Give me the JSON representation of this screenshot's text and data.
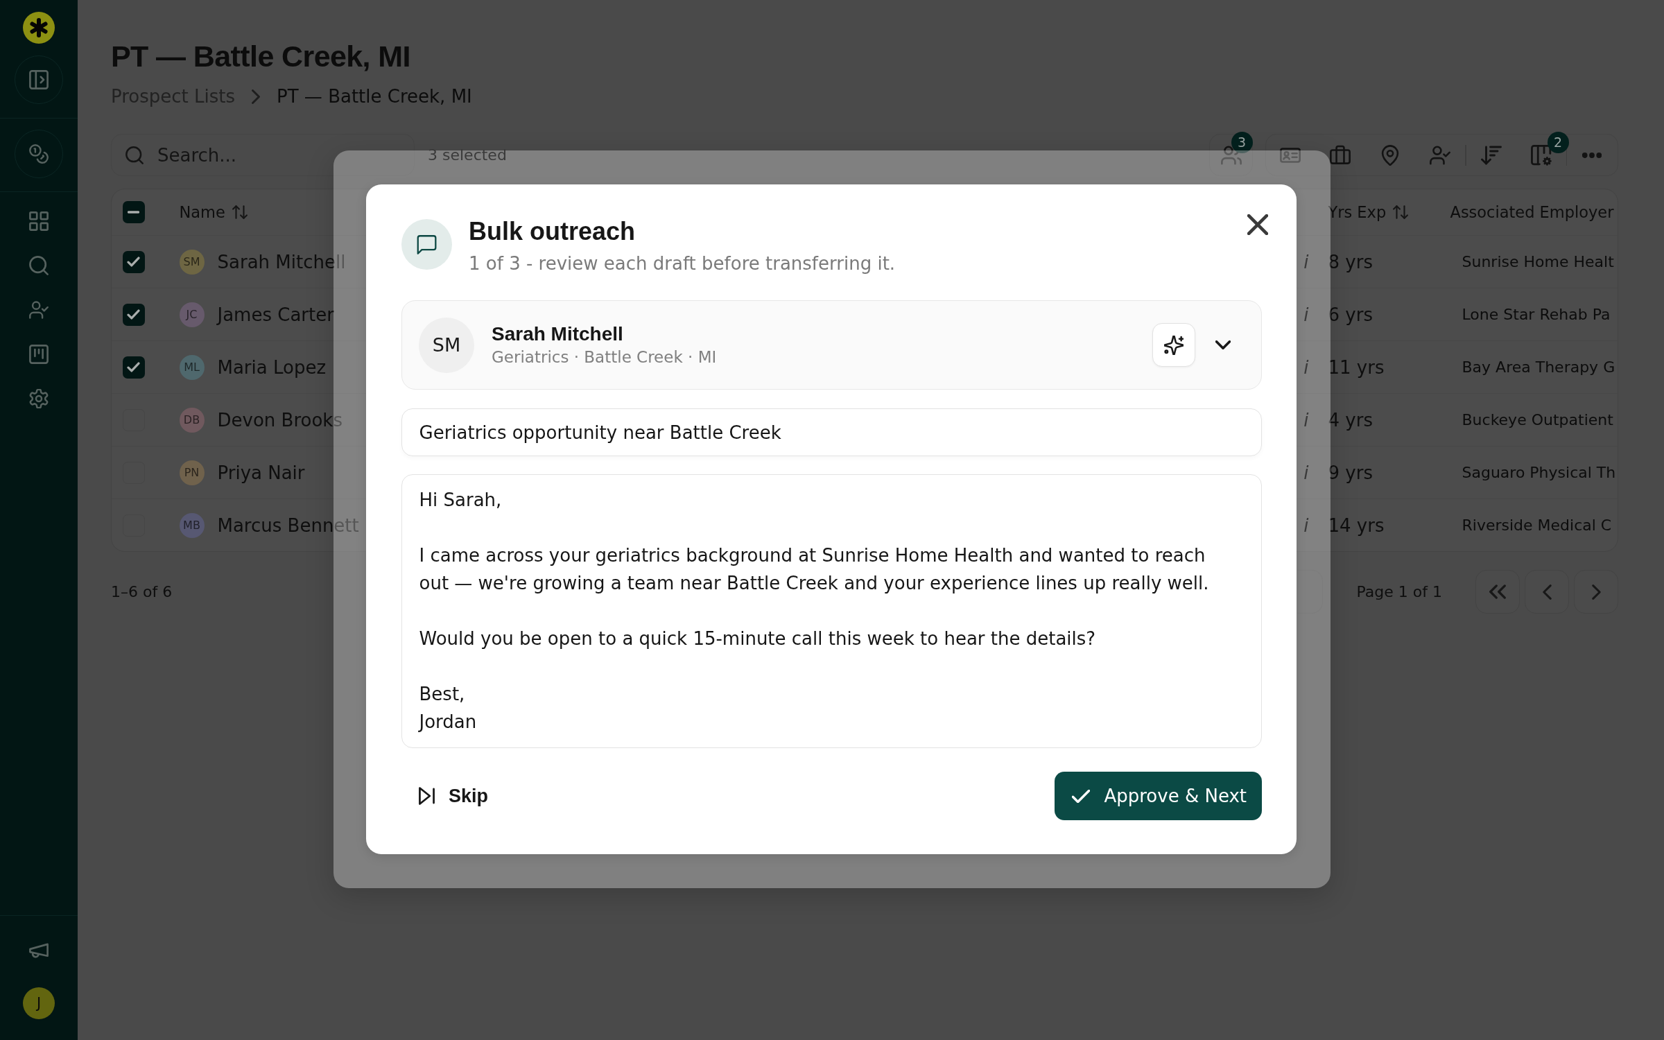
{
  "sidebar": {
    "user_initial": "J"
  },
  "page": {
    "title": "PT — Battle Creek, MI",
    "breadcrumbs": [
      {
        "label": "Prospect Lists",
        "selected": false
      },
      {
        "label": "PT — Battle Creek, MI",
        "selected": true
      }
    ]
  },
  "toolbar": {
    "search": {
      "placeholder": "Search..."
    },
    "selection_count": "3 selected",
    "groups": [
      {
        "sections": [
          [
            {
              "kind": "people",
              "badge": "3"
            }
          ]
        ]
      },
      {
        "sections": [
          [
            {
              "kind": "id-card"
            },
            {
              "kind": "briefcase"
            },
            {
              "kind": "map-pin"
            },
            {
              "kind": "user-check"
            }
          ],
          [
            {
              "kind": "sort"
            },
            {
              "kind": "columns",
              "badge": "2"
            }
          ],
          [
            {
              "kind": "more"
            }
          ]
        ]
      }
    ]
  },
  "table": {
    "select_all": {
      "indeterminate": true
    },
    "columns": [
      {
        "label": "Name",
        "sortable": true
      },
      {
        "label": "Yrs Exp",
        "sortable": true
      },
      {
        "label": "Associated Employer",
        "sortable": false
      }
    ],
    "rows": [
      {
        "checked": true,
        "initials": "SM",
        "color": "#6e6643",
        "name": "Sarah Mitchell",
        "column_3": "i",
        "years": "8 yrs",
        "employer": "Sunrise Home Healt"
      },
      {
        "checked": true,
        "initials": "JC",
        "color": "#675a6c",
        "name": "James Carter",
        "column_3": "i",
        "years": "6 yrs",
        "employer": "Lone Star Rehab Pa"
      },
      {
        "checked": true,
        "initials": "ML",
        "color": "#4f686d",
        "name": "Maria Lopez",
        "column_3": "i",
        "years": "11 yrs",
        "employer": "Bay Area Therapy G"
      },
      {
        "checked": false,
        "initials": "DB",
        "color": "#70595e",
        "name": "Devon Brooks",
        "column_3": "i",
        "years": "4 yrs",
        "employer": "Buckeye Outpatient"
      },
      {
        "checked": false,
        "initials": "PN",
        "color": "#70624c",
        "name": "Priya Nair",
        "column_3": "i",
        "years": "9 yrs",
        "employer": "Saguaro Physical Th"
      },
      {
        "checked": false,
        "initials": "MB",
        "color": "#575872",
        "name": "Marcus Bennett",
        "column_3": "i",
        "years": "14 yrs",
        "employer": "Riverside Medical C"
      }
    ]
  },
  "footer": {
    "range": "1–6 of 6",
    "page": "Page 1 of 1"
  },
  "dialog": {
    "title": "Bulk outreach",
    "subtitle": "1 of 3 - review each draft before transferring it.",
    "recipient": {
      "initials": "SM",
      "name": "Sarah Mitchell",
      "details": "Geriatrics · Battle Creek · MI"
    },
    "subject": "Geriatrics opportunity near Battle Creek",
    "body": "Hi Sarah,\n\nI came across your geriatrics background at Sunrise Home Health and wanted to reach out — we're growing a team near Battle Creek and your experience lines up really well.\n\nWould you be open to a quick 15-minute call this week to hear the details?\n\nBest,\nJordan",
    "skip_label": "Skip",
    "approve_label": "Approve & Next"
  }
}
